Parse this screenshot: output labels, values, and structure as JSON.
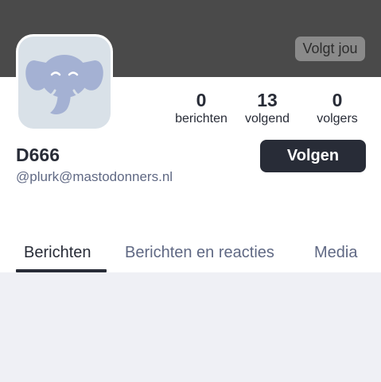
{
  "header": {
    "follows_you_label": "Volgt jou",
    "banner_color": "#4a4a4a"
  },
  "avatar": {
    "icon": "mastodon-elephant-icon",
    "background_color": "#d9e1e8"
  },
  "stats": {
    "posts": {
      "value": "0",
      "label": "berichten"
    },
    "following": {
      "value": "13",
      "label": "volgend"
    },
    "followers": {
      "value": "0",
      "label": "volgers"
    }
  },
  "profile": {
    "display_name": "D666",
    "handle": "@plurk@mastodonners.nl"
  },
  "actions": {
    "follow_label": "Volgen"
  },
  "tabs": [
    {
      "label": "Berichten",
      "active": true
    },
    {
      "label": "Berichten en reacties",
      "active": false
    },
    {
      "label": "Media",
      "active": false
    }
  ],
  "colors": {
    "text_primary": "#282c37",
    "text_secondary": "#606984",
    "button_bg": "#282c37",
    "content_bg": "#eff0f5"
  }
}
